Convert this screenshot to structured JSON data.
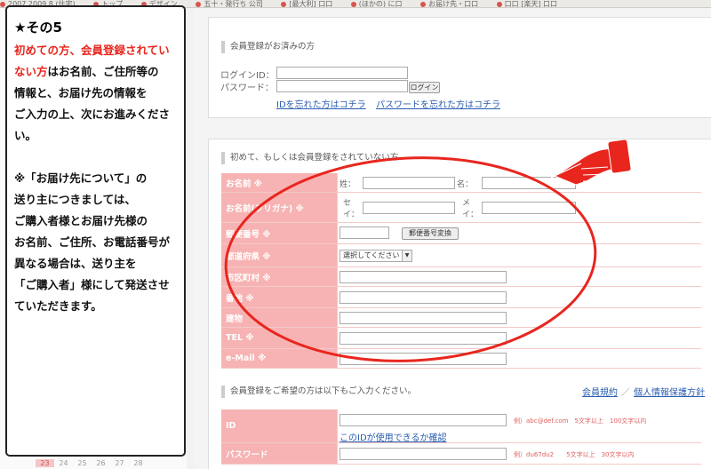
{
  "bookmarks": [
    "2007.2009.8 (住宅)",
    "トップ",
    "デザイン",
    "五十・発行ち 公司",
    "[最大利] 口口",
    "(ほかの) に口",
    "お届け先・口口",
    "口口 [楽天] 口口"
  ],
  "calendar": [
    "23",
    "24",
    "25",
    "26",
    "27",
    "28"
  ],
  "note": {
    "title": "★その5",
    "red_line": "初めての方、会員登録されていない方",
    "line1_rest": "はお名前、ご住所等の",
    "line2": "情報と、お届け先の情報を",
    "line3": "ご入力の上、次にお進みください。",
    "p2_line1": "※「お届け先について」の",
    "p2_line2": "送り主につきましては、",
    "p2_line3": "ご購入者様とお届け先様の",
    "p2_line4": "お名前、ご住所、お電話番号が",
    "p2_line5": "異なる場合は、送り主を",
    "p2_line6": "「ご購入者」様にして発送させ",
    "p2_line7": "ていただきます。"
  },
  "login": {
    "title": "会員登録がお済みの方",
    "id_label": "ログインID：",
    "pw_label": "パスワード：",
    "button": "ログイン",
    "forgot_id": "IDを忘れた方はコチラ",
    "forgot_pw": "パスワードを忘れた方はコチラ"
  },
  "guest": {
    "title": "初めて、もしくは会員登録をされていない方",
    "rows": {
      "name": "お名前 ※",
      "kana": "お名前(フリガナ) ※",
      "zip": "郵便番号 ※",
      "pref": "都道府県 ※",
      "city": "市区町村 ※",
      "address": "番地 ※",
      "building": "建物",
      "tel": "TEL ※",
      "email": "e-Mail ※"
    },
    "sei": "姓：",
    "mei": "名：",
    "sei_kana_1": "セ",
    "sei_kana_2": "イ：",
    "mei_kana_1": "メ",
    "mei_kana_2": "イ：",
    "zip_button": "郵便番号変換",
    "pref_selected": "選択してください"
  },
  "member": {
    "title": "会員登録をご希望の方は以下もご入力ください。",
    "terms_link": "会員規約",
    "separator": "／",
    "privacy_link": "個人情報保護方針",
    "id_label": "ID",
    "id_hint": "例）abc@def.com　5文字以上　100文字以内",
    "id_check": "このIDが使用できるか確認",
    "pw_label": "パスワード",
    "pw_hint": "例）du67du2　　5文字以上　30文字以内"
  },
  "colors": {
    "label_bg": "#f7b3b3",
    "annotation_red": "#e8261e",
    "link": "#2a5db0"
  }
}
